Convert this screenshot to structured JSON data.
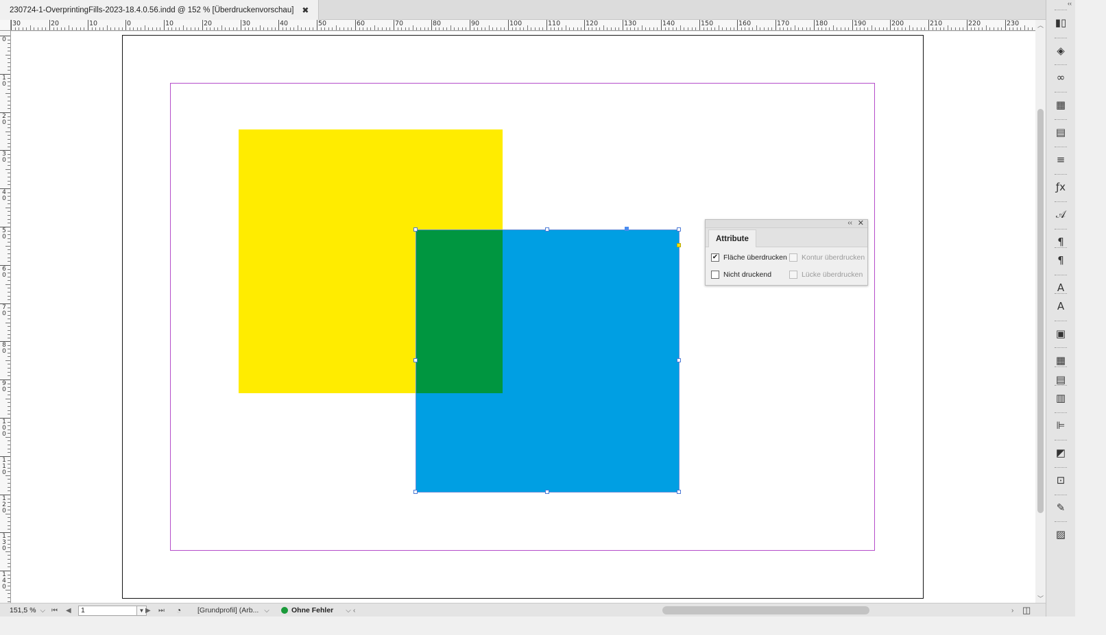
{
  "document_tab": {
    "title": "230724-1-OverprintingFills-2023-18.4.0.56.indd @ 152 % [Überdruckenvorschau]",
    "close_glyph": "✖"
  },
  "ruler_horizontal": {
    "labels": [
      "30",
      "20",
      "10",
      "0",
      "10",
      "20",
      "30",
      "40",
      "50",
      "60",
      "70",
      "80",
      "90",
      "100",
      "110",
      "120",
      "130",
      "140",
      "150",
      "160",
      "170",
      "180",
      "190",
      "200",
      "210",
      "220",
      "230"
    ]
  },
  "ruler_vertical": {
    "labels": [
      "0",
      "10",
      "20",
      "30",
      "40",
      "50",
      "60",
      "70",
      "80",
      "90",
      "100",
      "110",
      "120",
      "130",
      "140"
    ]
  },
  "canvas": {
    "colors": {
      "yellow_fill": "#ffec00",
      "cyan_fill": "#009fe3",
      "overprint_green": "#009640",
      "margin_guide": "#b44bc9"
    }
  },
  "attribute_panel": {
    "tab_label": "Attribute",
    "collapse_glyph": "‹‹",
    "close_glyph": "✕",
    "options": [
      {
        "label": "Fläche überdrucken",
        "checked": true,
        "enabled": true
      },
      {
        "label": "Kontur überdrucken",
        "checked": false,
        "enabled": false
      },
      {
        "label": "Nicht druckend",
        "checked": false,
        "enabled": true
      },
      {
        "label": "Lücke überdrucken",
        "checked": false,
        "enabled": false
      }
    ]
  },
  "right_panel_icons": [
    "pages-icon",
    "layers-icon",
    "links-icon",
    "swatches-icon",
    "gradient-icon",
    "stroke-icon",
    "effects-icon",
    "character-styles-icon",
    "paragraph-icon",
    "paragraph-styles-icon",
    "character-icon",
    "glyphs-icon",
    "text-wrap-icon",
    "table-icon",
    "table-styles-icon",
    "cell-styles-icon",
    "align-icon",
    "pathfinder-icon",
    "transform-icon",
    "object-styles-icon",
    "preflight-icon"
  ],
  "statusbar": {
    "zoom": "151,5 %",
    "page_number": "1",
    "profile": "[Grundprofil] (Arb...",
    "preflight_status": "Ohne Fehler",
    "preflight_color": "#1a9a3a"
  }
}
